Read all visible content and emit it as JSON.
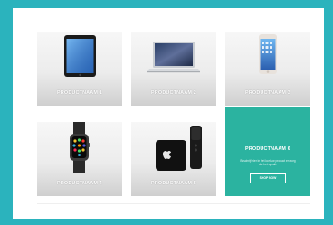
{
  "products": [
    {
      "name": "PRODUCTNAAM 1",
      "image": "ipad-icon"
    },
    {
      "name": "PRODUCTNAAM 2",
      "image": "macbook-icon"
    },
    {
      "name": "PRODUCTNAAM 3",
      "image": "iphone-icon"
    },
    {
      "name": "PRODUCTNAAM 4",
      "image": "apple-watch-icon"
    },
    {
      "name": "PRODUCTNAAM 5",
      "image": "apple-tv-icon"
    }
  ],
  "featured": {
    "title": "PRODUCTNAAM 6",
    "description": "Beschrijf hier in het kort uw product en zorg dat het opvalt.",
    "button_label": "SHOP NOW"
  },
  "colors": {
    "background": "#2bb3bd",
    "featured_tile": "#2bb3a0",
    "panel": "#ffffff"
  }
}
